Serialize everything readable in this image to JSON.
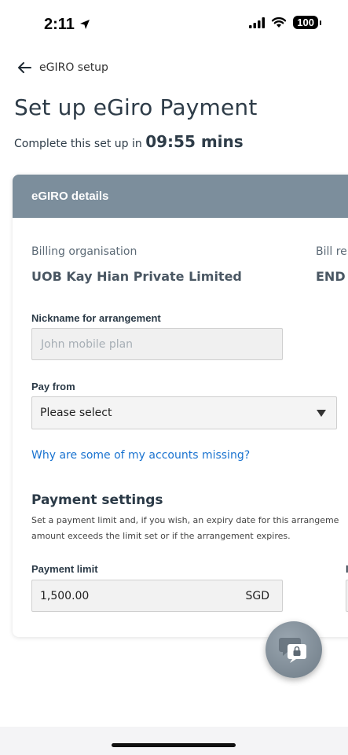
{
  "status_bar": {
    "time": "2:11",
    "battery": "100",
    "location_icon": "location-arrow-icon",
    "signal_icon": "cellular-signal-icon",
    "wifi_icon": "wifi-icon"
  },
  "nav": {
    "back_label": "eGIRO setup",
    "back_icon": "arrow-left-icon"
  },
  "page": {
    "title": "Set up eGiro Payment",
    "timer_prefix": "Complete this set up in",
    "timer_value": "09:55 mins"
  },
  "card": {
    "header": "eGIRO details",
    "billing_org_label": "Billing organisation",
    "billing_org_value": "UOB Kay Hian Private Limited",
    "bill_ref_label": "Bill re",
    "bill_ref_value": "END",
    "nickname_label": "Nickname for arrangement",
    "nickname_placeholder": "John mobile plan",
    "pay_from_label": "Pay from",
    "pay_from_value": "Please select",
    "missing_accounts_link": "Why are some of my accounts missing?",
    "payment_settings_title": "Payment settings",
    "payment_settings_desc_line1": "Set a payment limit and, if you wish, an expiry date for this arrangeme",
    "payment_settings_desc_line2": "amount exceeds the limit set or if the arrangement expires.",
    "payment_limit_label": "Payment limit",
    "payment_limit_value": "1,500.00",
    "payment_limit_currency": "SGD",
    "expiry_label_partial": "I"
  },
  "colors": {
    "card_header_bg": "#7c8e9c",
    "link": "#1a73d0",
    "text_dark": "#2b3a47"
  },
  "chat_button_icon": "chat-secure-icon"
}
